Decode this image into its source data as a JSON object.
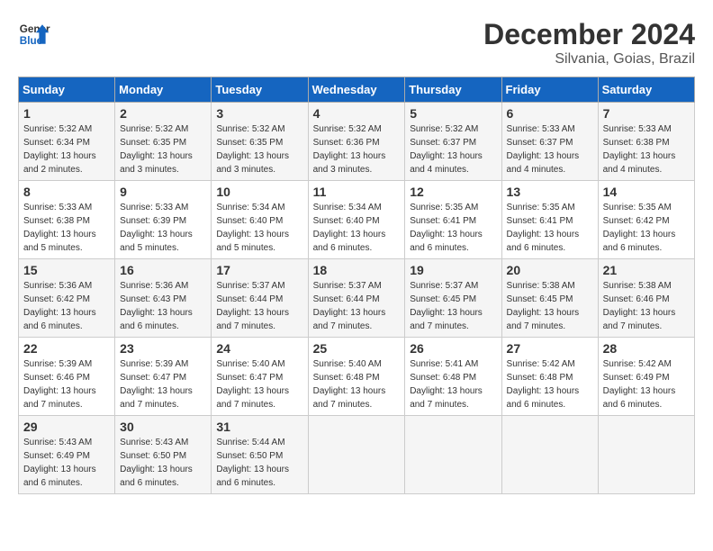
{
  "logo": {
    "line1": "General",
    "line2": "Blue"
  },
  "title": "December 2024",
  "location": "Silvania, Goias, Brazil",
  "weekdays": [
    "Sunday",
    "Monday",
    "Tuesday",
    "Wednesday",
    "Thursday",
    "Friday",
    "Saturday"
  ],
  "weeks": [
    [
      {
        "day": "1",
        "sunrise": "5:32 AM",
        "sunset": "6:34 PM",
        "daylight": "13 hours and 2 minutes."
      },
      {
        "day": "2",
        "sunrise": "5:32 AM",
        "sunset": "6:35 PM",
        "daylight": "13 hours and 3 minutes."
      },
      {
        "day": "3",
        "sunrise": "5:32 AM",
        "sunset": "6:35 PM",
        "daylight": "13 hours and 3 minutes."
      },
      {
        "day": "4",
        "sunrise": "5:32 AM",
        "sunset": "6:36 PM",
        "daylight": "13 hours and 3 minutes."
      },
      {
        "day": "5",
        "sunrise": "5:32 AM",
        "sunset": "6:37 PM",
        "daylight": "13 hours and 4 minutes."
      },
      {
        "day": "6",
        "sunrise": "5:33 AM",
        "sunset": "6:37 PM",
        "daylight": "13 hours and 4 minutes."
      },
      {
        "day": "7",
        "sunrise": "5:33 AM",
        "sunset": "6:38 PM",
        "daylight": "13 hours and 4 minutes."
      }
    ],
    [
      {
        "day": "8",
        "sunrise": "5:33 AM",
        "sunset": "6:38 PM",
        "daylight": "13 hours and 5 minutes."
      },
      {
        "day": "9",
        "sunrise": "5:33 AM",
        "sunset": "6:39 PM",
        "daylight": "13 hours and 5 minutes."
      },
      {
        "day": "10",
        "sunrise": "5:34 AM",
        "sunset": "6:40 PM",
        "daylight": "13 hours and 5 minutes."
      },
      {
        "day": "11",
        "sunrise": "5:34 AM",
        "sunset": "6:40 PM",
        "daylight": "13 hours and 6 minutes."
      },
      {
        "day": "12",
        "sunrise": "5:35 AM",
        "sunset": "6:41 PM",
        "daylight": "13 hours and 6 minutes."
      },
      {
        "day": "13",
        "sunrise": "5:35 AM",
        "sunset": "6:41 PM",
        "daylight": "13 hours and 6 minutes."
      },
      {
        "day": "14",
        "sunrise": "5:35 AM",
        "sunset": "6:42 PM",
        "daylight": "13 hours and 6 minutes."
      }
    ],
    [
      {
        "day": "15",
        "sunrise": "5:36 AM",
        "sunset": "6:42 PM",
        "daylight": "13 hours and 6 minutes."
      },
      {
        "day": "16",
        "sunrise": "5:36 AM",
        "sunset": "6:43 PM",
        "daylight": "13 hours and 6 minutes."
      },
      {
        "day": "17",
        "sunrise": "5:37 AM",
        "sunset": "6:44 PM",
        "daylight": "13 hours and 7 minutes."
      },
      {
        "day": "18",
        "sunrise": "5:37 AM",
        "sunset": "6:44 PM",
        "daylight": "13 hours and 7 minutes."
      },
      {
        "day": "19",
        "sunrise": "5:37 AM",
        "sunset": "6:45 PM",
        "daylight": "13 hours and 7 minutes."
      },
      {
        "day": "20",
        "sunrise": "5:38 AM",
        "sunset": "6:45 PM",
        "daylight": "13 hours and 7 minutes."
      },
      {
        "day": "21",
        "sunrise": "5:38 AM",
        "sunset": "6:46 PM",
        "daylight": "13 hours and 7 minutes."
      }
    ],
    [
      {
        "day": "22",
        "sunrise": "5:39 AM",
        "sunset": "6:46 PM",
        "daylight": "13 hours and 7 minutes."
      },
      {
        "day": "23",
        "sunrise": "5:39 AM",
        "sunset": "6:47 PM",
        "daylight": "13 hours and 7 minutes."
      },
      {
        "day": "24",
        "sunrise": "5:40 AM",
        "sunset": "6:47 PM",
        "daylight": "13 hours and 7 minutes."
      },
      {
        "day": "25",
        "sunrise": "5:40 AM",
        "sunset": "6:48 PM",
        "daylight": "13 hours and 7 minutes."
      },
      {
        "day": "26",
        "sunrise": "5:41 AM",
        "sunset": "6:48 PM",
        "daylight": "13 hours and 7 minutes."
      },
      {
        "day": "27",
        "sunrise": "5:42 AM",
        "sunset": "6:48 PM",
        "daylight": "13 hours and 6 minutes."
      },
      {
        "day": "28",
        "sunrise": "5:42 AM",
        "sunset": "6:49 PM",
        "daylight": "13 hours and 6 minutes."
      }
    ],
    [
      {
        "day": "29",
        "sunrise": "5:43 AM",
        "sunset": "6:49 PM",
        "daylight": "13 hours and 6 minutes."
      },
      {
        "day": "30",
        "sunrise": "5:43 AM",
        "sunset": "6:50 PM",
        "daylight": "13 hours and 6 minutes."
      },
      {
        "day": "31",
        "sunrise": "5:44 AM",
        "sunset": "6:50 PM",
        "daylight": "13 hours and 6 minutes."
      },
      null,
      null,
      null,
      null
    ]
  ],
  "labels": {
    "sunrise": "Sunrise:",
    "sunset": "Sunset:",
    "daylight": "Daylight:"
  }
}
